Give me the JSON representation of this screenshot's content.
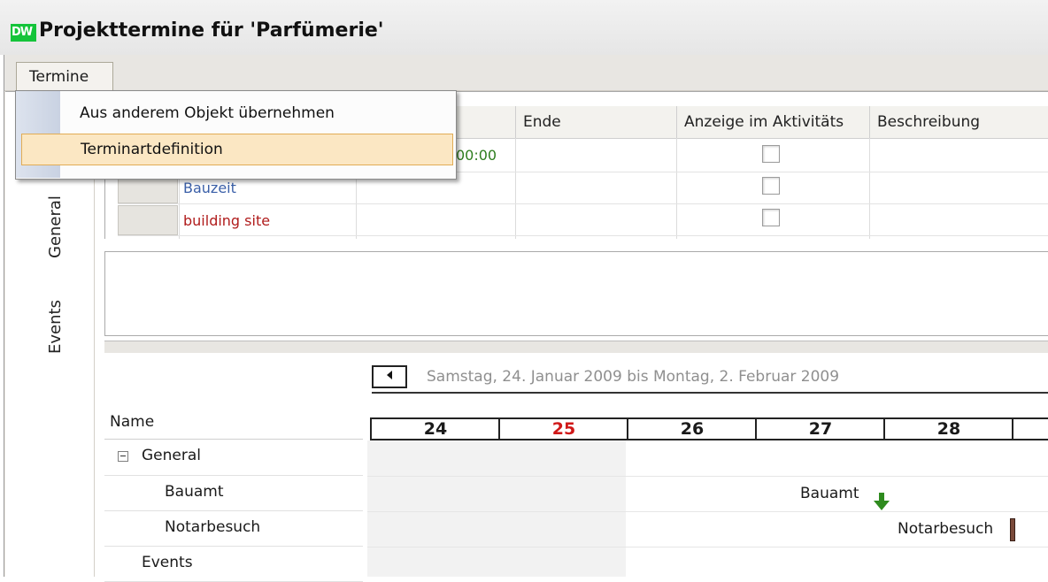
{
  "window": {
    "title": "Projekttermine für 'Parfümerie'",
    "logo_text": "DW",
    "logo_color": "#14c43a"
  },
  "menubar": {
    "termine_label": "Termine"
  },
  "dropdown": {
    "items": [
      {
        "label": "Aus anderem Objekt übernehmen"
      },
      {
        "label": "Terminartdefinition"
      }
    ]
  },
  "side_tabs": [
    {
      "label": "General"
    },
    {
      "label": "Events"
    }
  ],
  "grid": {
    "columns": [
      {
        "label": "Ende"
      },
      {
        "label": "Anzeige im Aktivitäts"
      },
      {
        "label": "Beschreibung"
      }
    ],
    "rows": [
      {
        "name": "",
        "start_partial": "00:00",
        "start_color": "#2e7d1e"
      },
      {
        "name": "Bauzeit",
        "name_color": "#3a5fa8"
      },
      {
        "name": "building site",
        "name_color": "#b01c1c"
      }
    ]
  },
  "gantt": {
    "range": "Samstag, 24. Januar 2009   bis   Montag, 2. Februar 2009",
    "name_header": "Name",
    "days": [
      {
        "label": "24"
      },
      {
        "label": "25",
        "color": "#d01818"
      },
      {
        "label": "26"
      },
      {
        "label": "27"
      },
      {
        "label": "28"
      }
    ],
    "tree": [
      {
        "label": "General"
      },
      {
        "label": "Bauamt"
      },
      {
        "label": "Notarbesuch"
      },
      {
        "label": "Events"
      }
    ],
    "bars": [
      {
        "label": "Bauamt",
        "marker": "green-down-arrow"
      },
      {
        "label": "Notarbesuch",
        "marker": "task-bar"
      }
    ]
  }
}
